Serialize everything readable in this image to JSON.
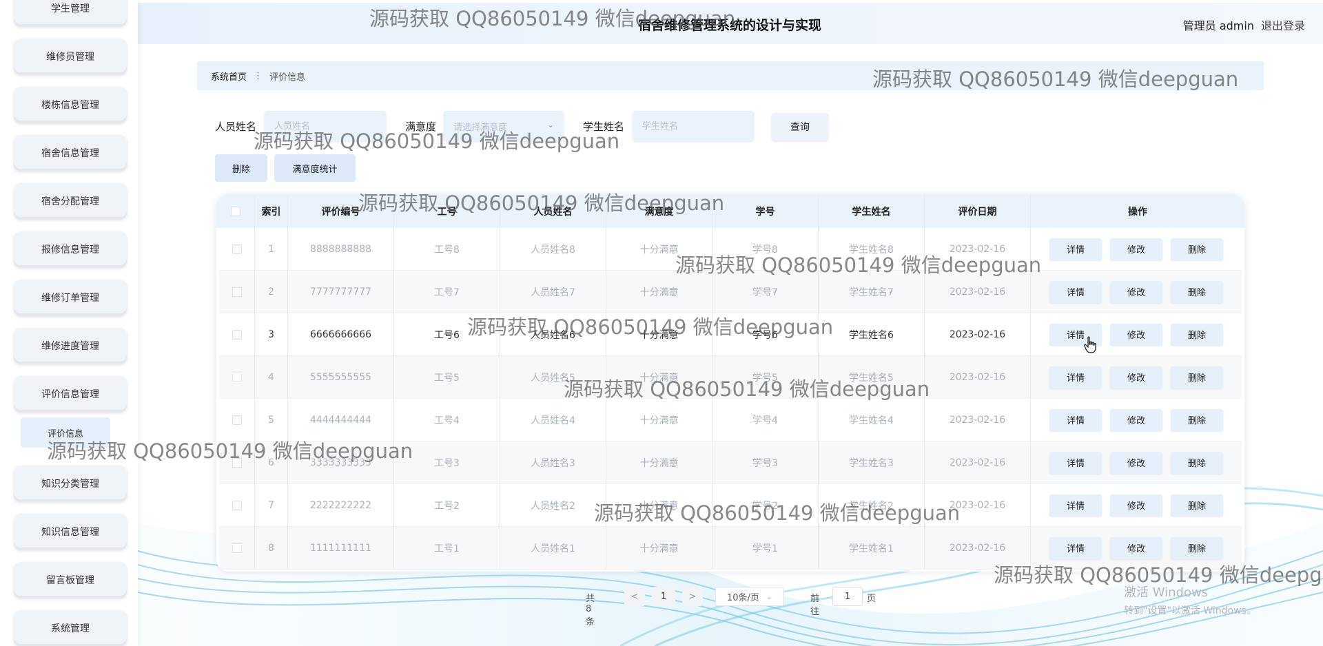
{
  "app": {
    "title": "宿舍维修管理系统的设计与实现",
    "user_label": "管理员 admin",
    "logout": "退出登录"
  },
  "sidebar": {
    "items": [
      {
        "label": "学生管理"
      },
      {
        "label": "维修员管理"
      },
      {
        "label": "楼栋信息管理"
      },
      {
        "label": "宿舍信息管理"
      },
      {
        "label": "宿舍分配管理"
      },
      {
        "label": "报修信息管理"
      },
      {
        "label": "维修订单管理"
      },
      {
        "label": "维修进度管理"
      },
      {
        "label": "评价信息管理"
      },
      {
        "label": "知识分类管理"
      },
      {
        "label": "知识信息管理"
      },
      {
        "label": "留言板管理"
      },
      {
        "label": "系统管理"
      }
    ],
    "active_sub": "评价信息"
  },
  "breadcrumb": {
    "home": "系统首页",
    "separator": "⋮",
    "current": "评价信息"
  },
  "search": {
    "staff_name_label": "人员姓名",
    "staff_name_placeholder": "人员姓名",
    "satisfaction_label": "满意度",
    "satisfaction_placeholder": "请选择满意度",
    "student_name_label": "学生姓名",
    "student_name_placeholder": "学生姓名",
    "query_button": "查询"
  },
  "actions": {
    "delete": "删除",
    "stats": "满意度统计"
  },
  "table": {
    "headers": [
      "索引",
      "评价编号",
      "工号",
      "人员姓名",
      "满意度",
      "学号",
      "学生姓名",
      "评价日期",
      "操作"
    ],
    "rows": [
      {
        "index": "1",
        "code": "8888888888",
        "staff_no": "工号8",
        "staff_name": "人员姓名8",
        "satisfaction": "十分满意",
        "student_no": "学号8",
        "student_name": "学生姓名8",
        "date": "2023-02-16"
      },
      {
        "index": "2",
        "code": "7777777777",
        "staff_no": "工号7",
        "staff_name": "人员姓名7",
        "satisfaction": "十分满意",
        "student_no": "学号7",
        "student_name": "学生姓名7",
        "date": "2023-02-16"
      },
      {
        "index": "3",
        "code": "6666666666",
        "staff_no": "工号6",
        "staff_name": "人员姓名6",
        "satisfaction": "十分满意",
        "student_no": "学号6",
        "student_name": "学生姓名6",
        "date": "2023-02-16"
      },
      {
        "index": "4",
        "code": "5555555555",
        "staff_no": "工号5",
        "staff_name": "人员姓名5",
        "satisfaction": "十分满意",
        "student_no": "学号5",
        "student_name": "学生姓名5",
        "date": "2023-02-16"
      },
      {
        "index": "5",
        "code": "4444444444",
        "staff_no": "工号4",
        "staff_name": "人员姓名4",
        "satisfaction": "十分满意",
        "student_no": "学号4",
        "student_name": "学生姓名4",
        "date": "2023-02-16"
      },
      {
        "index": "6",
        "code": "3333333333",
        "staff_no": "工号3",
        "staff_name": "人员姓名3",
        "satisfaction": "十分满意",
        "student_no": "学号3",
        "student_name": "学生姓名3",
        "date": "2023-02-16"
      },
      {
        "index": "7",
        "code": "2222222222",
        "staff_no": "工号2",
        "staff_name": "人员姓名2",
        "satisfaction": "十分满意",
        "student_no": "学号2",
        "student_name": "学生姓名2",
        "date": "2023-02-16"
      },
      {
        "index": "8",
        "code": "1111111111",
        "staff_no": "工号1",
        "staff_name": "人员姓名1",
        "satisfaction": "十分满意",
        "student_no": "学号1",
        "student_name": "学生姓名1",
        "date": "2023-02-16"
      }
    ],
    "row_buttons": {
      "detail": "详情",
      "edit": "修改",
      "delete": "删除"
    }
  },
  "pagination": {
    "total": "共 8 条",
    "prev": "<",
    "page": "1",
    "next": ">",
    "page_size": "10条/页",
    "goto_label": "前往",
    "goto_value": "1",
    "goto_suffix": "页"
  },
  "windows": {
    "line1": "激活 Windows",
    "line2": "转到\"设置\"以激活 Windows。"
  },
  "watermark": "源码获取 QQ86050149 微信deepguan",
  "colors": {
    "accent": "#eaf2fb",
    "button": "#dce9f8",
    "sidebar_item": "#f0f3f8"
  }
}
